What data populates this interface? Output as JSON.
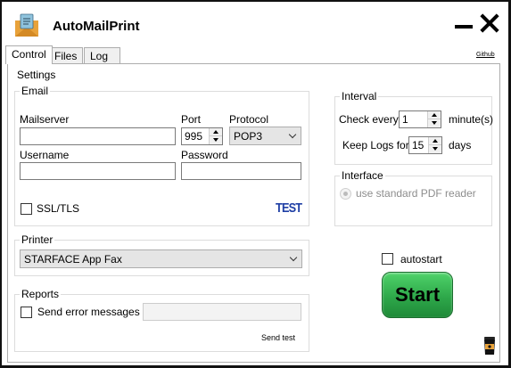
{
  "window": {
    "title": "AutoMailPrint"
  },
  "tabs": [
    {
      "label": "Control",
      "active": true
    },
    {
      "label": "Files",
      "active": false
    },
    {
      "label": "Log",
      "active": false
    }
  ],
  "github_link": "Github",
  "settings": {
    "label": "Settings"
  },
  "email": {
    "legend": "Email",
    "mailserver_label": "Mailserver",
    "mailserver_value": "",
    "port_label": "Port",
    "port_value": "995",
    "protocol_label": "Protocol",
    "protocol_value": "POP3",
    "username_label": "Username",
    "username_value": "",
    "password_label": "Password",
    "password_value": "",
    "ssl_label": "SSL/TLS",
    "ssl_checked": false,
    "test_label": "TEST"
  },
  "printer": {
    "legend": "Printer",
    "selected": "STARFACE App Fax"
  },
  "reports": {
    "legend": "Reports",
    "send_errors_label": "Send error messages to",
    "send_errors_checked": false,
    "email_value": "",
    "send_test_label": "Send test"
  },
  "interval": {
    "legend": "Interval",
    "check_every_label": "Check every",
    "check_every_value": "1",
    "minutes_label": "minute(s)",
    "keep_logs_label": "Keep Logs for",
    "keep_logs_value": "15",
    "days_label": "days"
  },
  "interface": {
    "legend": "Interface",
    "pdf_reader_label": "use standard PDF reader",
    "pdf_reader_enabled": false
  },
  "autostart": {
    "label": "autostart",
    "checked": false
  },
  "start_button": {
    "label": "Start"
  },
  "colors": {
    "start_green": "#2ea84a",
    "test_blue": "#1f3fa5",
    "window_border": "#111111",
    "coffee_orange": "#e8a23a"
  },
  "icons": {
    "app": "mail-envelope-icon",
    "coffee": "coffee-cup-icon"
  }
}
